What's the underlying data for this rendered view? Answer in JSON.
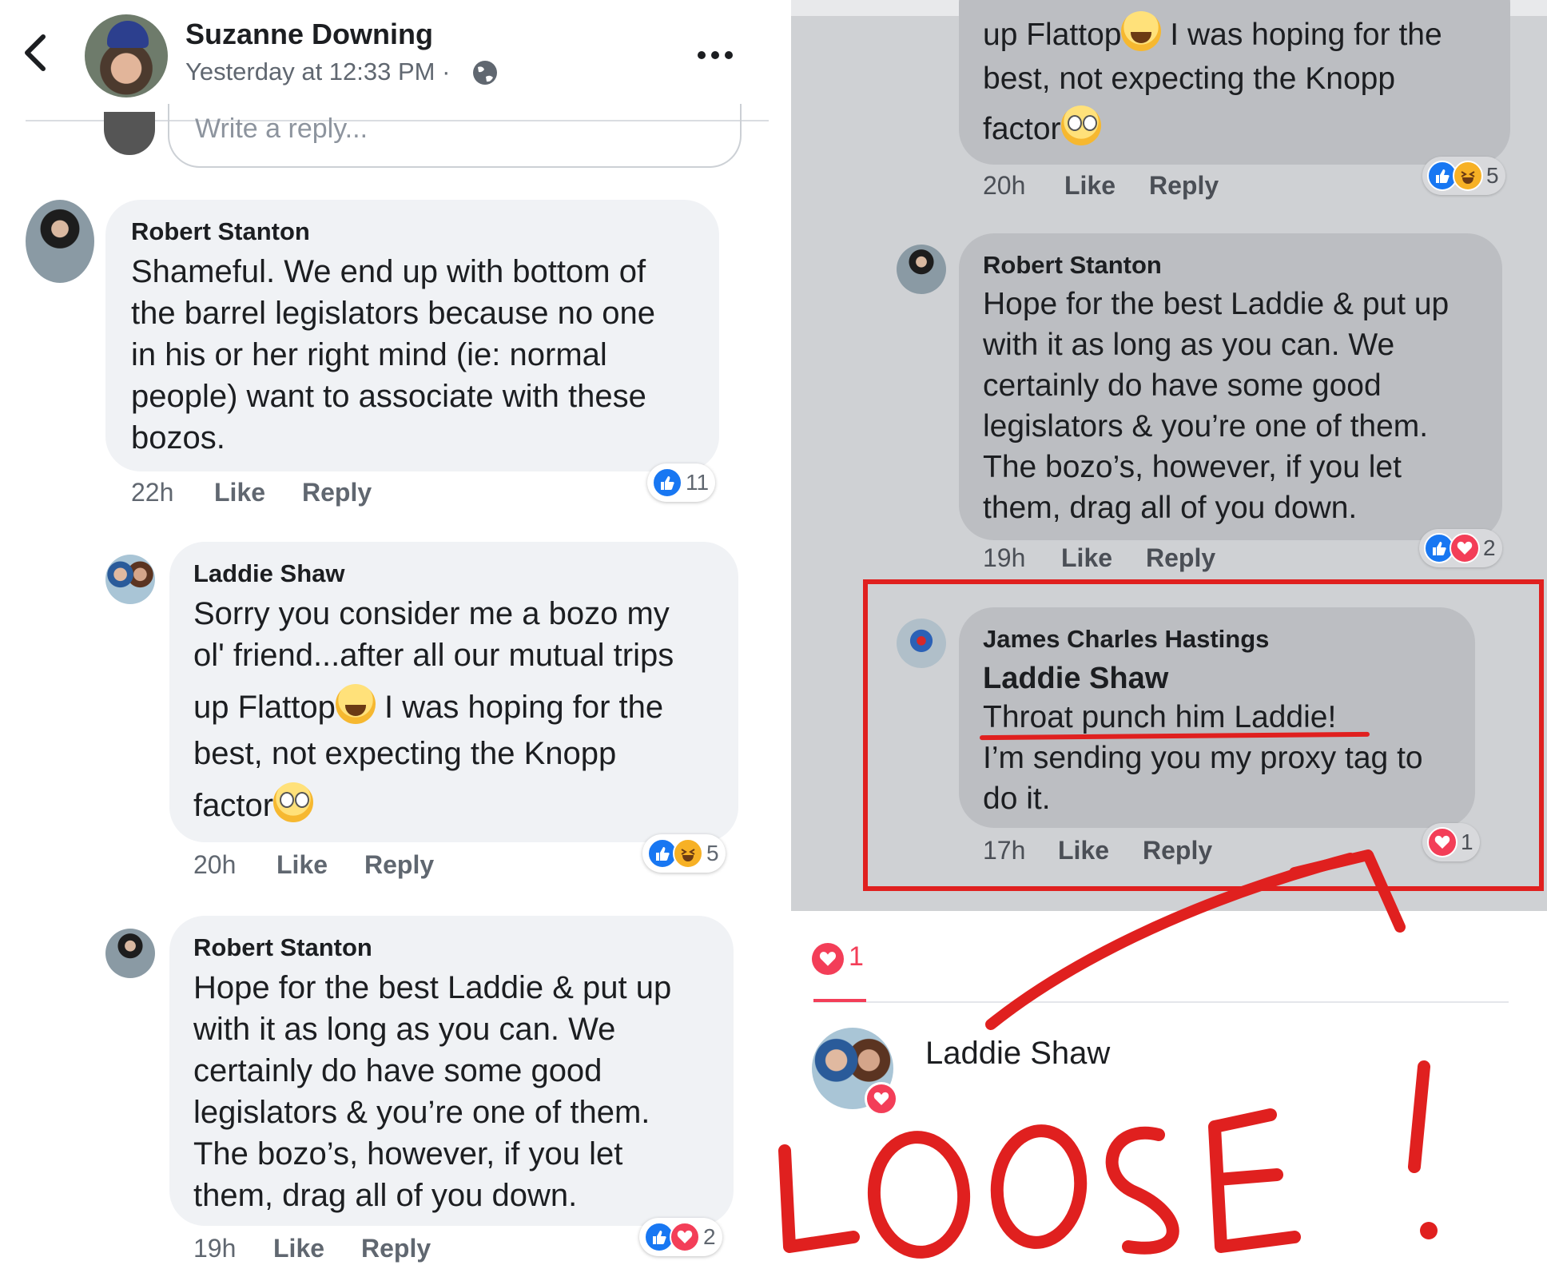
{
  "left": {
    "header": {
      "name": "Suzanne Downing",
      "time": "Yesterday at 12:33 PM · "
    },
    "reply_placeholder": "Write a reply...",
    "comments": [
      {
        "author": "Robert Stanton",
        "lines": [
          "Shameful.  We end up with bottom of",
          "the barrel legislators because no one",
          "in his or her right mind (ie: normal",
          "people) want to associate with these",
          "bozos."
        ],
        "time": "22h",
        "like": "Like",
        "reply": "Reply",
        "reactions": [
          "like"
        ],
        "reaction_count": "11"
      },
      {
        "author": "Laddie Shaw",
        "lines": [
          "Sorry you consider me a bozo my",
          "ol' friend...after all our mutual trips",
          "up Flattop",
          " I was hoping for the",
          "best, not expecting the Knopp",
          "factor"
        ],
        "time": "20h",
        "like": "Like",
        "reply": "Reply",
        "reactions": [
          "like",
          "haha"
        ],
        "reaction_count": "5"
      },
      {
        "author": "Robert Stanton",
        "lines": [
          "Hope for the best Laddie & put up",
          "with it as long as you can.  We",
          "certainly do have some good",
          "legislators & you’re one of them.",
          "The bozo’s, however, if you let",
          "them, drag all of you down."
        ],
        "time": "19h",
        "like": "Like",
        "reply": "Reply",
        "reactions": [
          "like",
          "love"
        ],
        "reaction_count": "2"
      }
    ]
  },
  "right": {
    "top_comment": {
      "lines": [
        "up Flattop",
        " I was hoping for the",
        "best, not expecting the Knopp",
        "factor"
      ],
      "time": "20h",
      "like": "Like",
      "reply": "Reply",
      "reaction_count": "5"
    },
    "robert": {
      "author": "Robert Stanton",
      "lines": [
        "Hope for the best Laddie & put up",
        "with it as long as you can.  We",
        "certainly do have some good",
        "legislators & you’re one of them.",
        "The bozo’s, however, if you let",
        "them, drag all of you down."
      ],
      "time": "19h",
      "like": "Like",
      "reply": "Reply",
      "reaction_count": "2"
    },
    "james": {
      "author": "James Charles Hastings",
      "tag": "Laddie Shaw",
      "lines": [
        "Throat punch him Laddie!",
        "I’m sending you my proxy tag to",
        "do it."
      ],
      "time": "17h",
      "like": "Like",
      "reply": "Reply",
      "reaction_count": "1"
    },
    "reactions_panel": {
      "tab_count": "1",
      "reactor": "Laddie Shaw"
    },
    "annotation_text": "LOOSE!"
  },
  "colors": {
    "like_blue": "#1877f2",
    "love_red": "#f33e58",
    "annotation_red": "#e0201f"
  },
  "icons": [
    "back-chevron-icon",
    "globe-icon",
    "more-icon",
    "thumbs-up-icon",
    "heart-icon",
    "laughing-emoji-icon",
    "eye-roll-emoji-icon"
  ]
}
